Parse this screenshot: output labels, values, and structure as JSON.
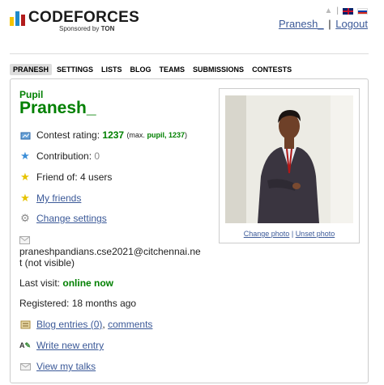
{
  "header": {
    "logo_title": "CODEFORCES",
    "logo_sub_prefix": "Sponsored by",
    "logo_sub_brand": "TON",
    "user_link": "Pranesh_",
    "separator": "|",
    "logout_label": "Logout"
  },
  "menu": [
    "PRANESH",
    "SETTINGS",
    "LISTS",
    "BLOG",
    "TEAMS",
    "SUBMISSIONS",
    "CONTESTS"
  ],
  "profile": {
    "rank": "Pupil",
    "handle": "Pranesh_",
    "contest_rating_label": "Contest rating:",
    "contest_rating_value": "1237",
    "max_prefix": "(max.",
    "max_rank": "pupil, 1237",
    "max_suffix": ")",
    "contribution_label": "Contribution:",
    "contribution_value": "0",
    "friend_of": "Friend of: 4 users",
    "my_friends": "My friends",
    "change_settings": "Change settings",
    "email": "praneshpandians.cse2021@citchennai.net (not visible)",
    "last_visit_label": "Last visit:",
    "last_visit_value": "online now",
    "registered": "Registered: 18 months ago",
    "blog_entries": "Blog entries (0)",
    "comma": ",",
    "comments": "comments",
    "write_new_entry": "Write new entry",
    "view_my_talks": "View my talks"
  },
  "photo": {
    "change_photo": "Change photo",
    "link_separator": "|",
    "unset_photo": "Unset photo"
  },
  "colors": {
    "rank_green": "#008000",
    "link_blue": "#3b5998"
  },
  "icons": [
    "rating-icon",
    "contribution-star-icon",
    "friend-star-icon",
    "friends-star-icon",
    "settings-gear-icon",
    "email-envelope-icon",
    "blog-icon",
    "write-icon",
    "talks-icon",
    "lock-icon"
  ]
}
